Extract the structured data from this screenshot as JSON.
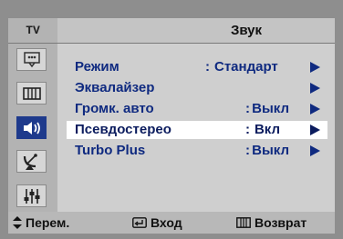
{
  "header": {
    "source": "TV",
    "title": "Звук"
  },
  "sidebar": {
    "items": [
      {
        "icon": "picture-icon",
        "active": false
      },
      {
        "icon": "picture-grid-icon",
        "active": false
      },
      {
        "icon": "speaker-icon",
        "active": true
      },
      {
        "icon": "satellite-icon",
        "active": false
      },
      {
        "icon": "setup-sliders-icon",
        "active": false
      }
    ]
  },
  "menu": {
    "items": [
      {
        "label": "Режим",
        "sep": ":",
        "value": "Стандарт",
        "selected": false
      },
      {
        "label": "Эквалайзер",
        "sep": "",
        "value": "",
        "selected": false
      },
      {
        "label": "Громк. авто",
        "sep": ":",
        "value": "Выкл",
        "selected": false
      },
      {
        "label": "Псевдостерео",
        "sep": ":",
        "value": "Вкл",
        "selected": true
      },
      {
        "label": "Turbo Plus",
        "sep": ":",
        "value": "Выкл",
        "selected": false
      }
    ]
  },
  "footer": {
    "move_label": "Перем.",
    "enter_label": "Вход",
    "return_label": "Возврат"
  },
  "colors": {
    "menu_text": "#0f2a80",
    "active_icon_bg": "#1e3a8c",
    "selected_row_bg": "#ffffff"
  }
}
